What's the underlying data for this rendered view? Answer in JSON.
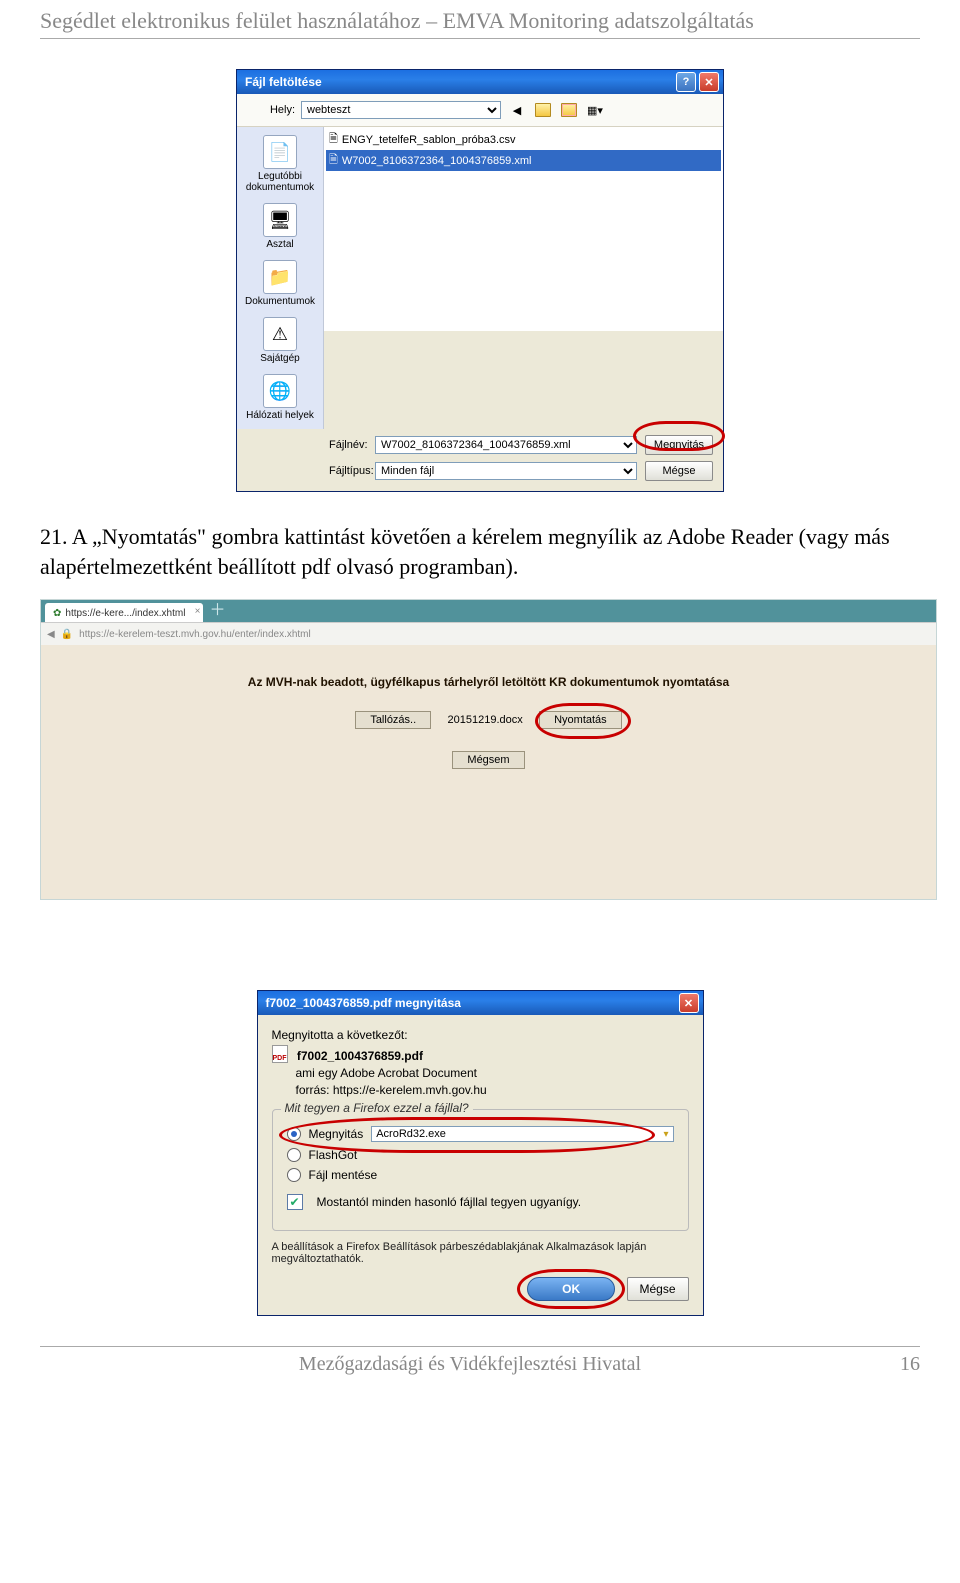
{
  "doc_header": "Segédlet elektronikus felület használatához – EMVA Monitoring adatszolgáltatás",
  "upload_dialog": {
    "title": "Fájl feltöltése",
    "location_label": "Hely:",
    "location_value": "webteszt",
    "places": [
      {
        "icon": "📄",
        "label": "Legutóbbi dokumentumok"
      },
      {
        "icon": "🖥",
        "label": "Asztal"
      },
      {
        "icon": "📁",
        "label": "Dokumentumok"
      },
      {
        "icon": "⚠",
        "label": "Sajátgép"
      },
      {
        "icon": "🌐",
        "label": "Hálózati helyek"
      }
    ],
    "files": [
      {
        "name": "ENGY_tetelfeR_sablon_próba3.csv",
        "selected": false
      },
      {
        "name": "W7002_8106372364_1004376859.xml",
        "selected": true
      }
    ],
    "filename_label": "Fájlnév:",
    "filename_value": "W7002_8106372364_1004376859.xml",
    "filetype_label": "Fájltípus:",
    "filetype_value": "Minden fájl",
    "open_label": "Megnyitás",
    "cancel_label": "Mégse"
  },
  "body_text": "21. A „Nyomtatás\" gombra kattintást követően a kérelem megnyílik az Adobe Reader (vagy más alapértelmezettként beállított pdf olvasó programban).",
  "web": {
    "tab": "https://e-kere.../index.xhtml",
    "url": "https://e-kerelem-teszt.mvh.gov.hu/enter/index.xhtml",
    "title": "Az MVH-nak beadott, ügyfélkapus tárhelyről letöltött KR dokumentumok nyomtatása",
    "browse": "Tallózás..",
    "filename": "20151219.docx",
    "print": "Nyomtatás",
    "cancel": "Mégsem"
  },
  "fx": {
    "title": "f7002_1004376859.pdf megnyitása",
    "opened": "Megnyitotta a következőt:",
    "file": "f7002_1004376859.pdf",
    "which_is": "ami egy",
    "doctype": "Adobe Acrobat Document",
    "source_lbl": "forrás:",
    "source": "https://e-kerelem.mvh.gov.hu",
    "legend": "Mit tegyen a Firefox ezzel a fájllal?",
    "open_with": "Megnyitás",
    "app": "AcroRd32.exe",
    "flashgot": "FlashGot",
    "save": "Fájl mentése",
    "remember": "Mostantól minden hasonló fájllal tegyen ugyanígy.",
    "note": "A beállítások a Firefox Beállítások párbeszédablakjának Alkalmazások lapján megváltoztathatók.",
    "ok": "OK",
    "cancel": "Mégse"
  },
  "footer": {
    "org": "Mezőgazdasági és Vidékfejlesztési Hivatal",
    "page": "16"
  }
}
